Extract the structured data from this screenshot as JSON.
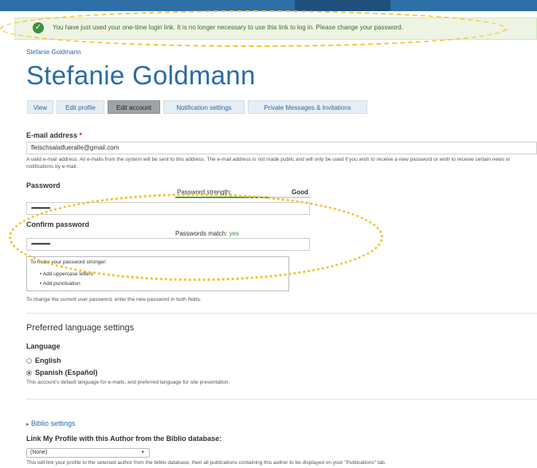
{
  "status_message": "You have just used your one-time login link. It is no longer necessary to use this link to log in. Please change your password.",
  "breadcrumb": "Stefanie Goldmann",
  "page_title": "Stefanie Goldmann",
  "tabs": [
    "View",
    "Edit profile",
    "Edit account",
    "Notification settings",
    "Private Messages & Invitations"
  ],
  "email": {
    "label": "E-mail address",
    "required_mark": "*",
    "value": "fleischsalatfueralle@gmail.com",
    "description": "A valid e-mail address. All e-mails from the system will be sent to this address. The e-mail address is not made public and will only be used if you wish to receive a new password or wish to receive certain news or notifications by e-mail."
  },
  "password": {
    "label": "Password",
    "strength_label": "Password strength:",
    "strength_value": "Good",
    "strength_fraction": 0.7,
    "value": "•••••••••••••"
  },
  "confirm_password": {
    "label": "Confirm password",
    "match_label": "Passwords match:",
    "match_value": "yes",
    "value": "•••••••••••••"
  },
  "tips": {
    "title": "To make your password stronger:",
    "items": [
      "Add uppercase letters",
      "Add punctuation"
    ]
  },
  "password_help": "To change the current user password, enter the new password in both fields.",
  "language_section": {
    "title": "Preferred language settings",
    "label": "Language",
    "options": [
      "English",
      "Spanish (Español)"
    ],
    "selected_index": 1,
    "description": "This account's default language for e-mails, and preferred language for site presentation."
  },
  "biblio": {
    "toggle": "Biblio settings",
    "label": "Link My Profile with this Author from the Biblio database:",
    "select_value": "(None)",
    "description": "This will link your profile to the selected author from the biblio database, then all publications containing this author to be displayed on your \"Publications\" tab."
  },
  "colors": {
    "link": "#2a6aa8",
    "success": "#3f8f3a",
    "highlight": "#f3c431"
  }
}
